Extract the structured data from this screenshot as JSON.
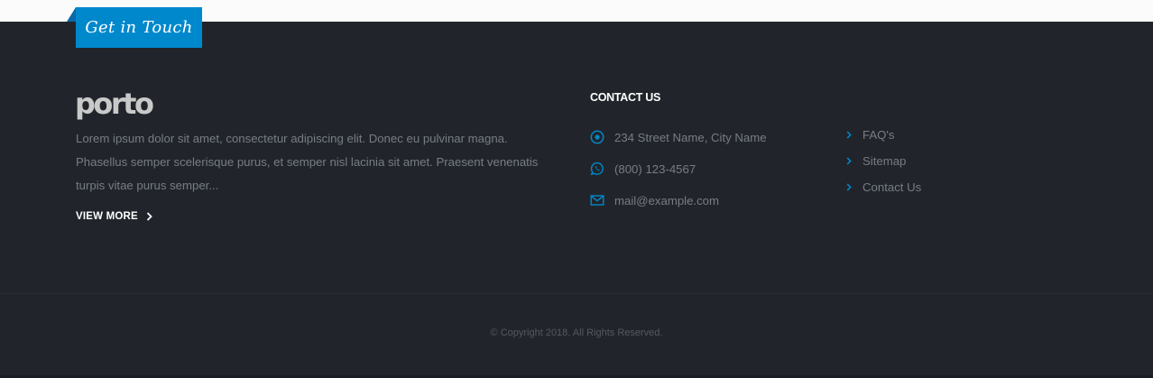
{
  "header": {
    "ribbon_label": "Get in Touch"
  },
  "about": {
    "logo_text": "porto",
    "text": "Lorem ipsum dolor sit amet, consectetur adipiscing elit. Donec eu pulvinar magna. Phasellus semper scelerisque purus, et semper nisl lacinia sit amet. Praesent venenatis turpis vitae purus semper...",
    "view_more_label": "VIEW MORE"
  },
  "contact": {
    "title": "CONTACT US",
    "items": [
      {
        "icon": "location-icon",
        "text": "234 Street Name, City Name"
      },
      {
        "icon": "whatsapp-icon",
        "text": "(800) 123-4567"
      },
      {
        "icon": "envelope-icon",
        "text": "mail@example.com"
      }
    ]
  },
  "links": {
    "items": [
      {
        "label": "FAQ's"
      },
      {
        "label": "Sitemap"
      },
      {
        "label": "Contact Us"
      }
    ]
  },
  "copyright": {
    "text": "© Copyright 2018. All Rights Reserved."
  },
  "colors": {
    "accent": "#0088cc",
    "footer_bg": "#21252b",
    "text_muted": "#777d83"
  }
}
